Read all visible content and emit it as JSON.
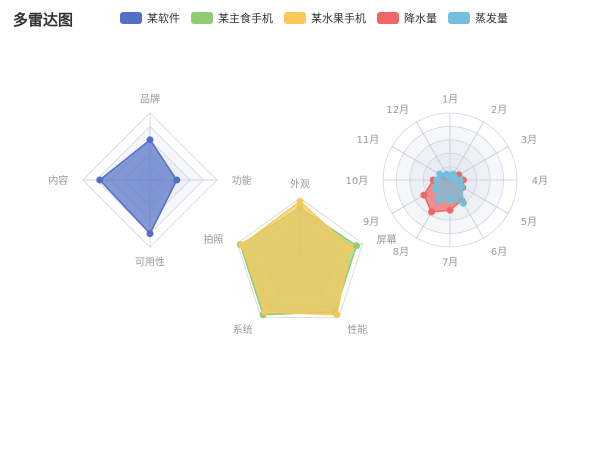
{
  "chart_data": {
    "type": "radar",
    "title": "多雷达图",
    "legend": [
      {
        "name": "某软件",
        "color": "#5470c6"
      },
      {
        "name": "某主食手机",
        "color": "#91cc75"
      },
      {
        "name": "某水果手机",
        "color": "#fac858"
      },
      {
        "name": "降水量",
        "color": "#ee6666"
      },
      {
        "name": "蒸发量",
        "color": "#73c0de"
      }
    ],
    "radars": [
      {
        "indicators": [
          {
            "name": "品牌",
            "max": 100
          },
          {
            "name": "功能",
            "max": 100
          },
          {
            "name": "可用性",
            "max": 100
          },
          {
            "name": "内容",
            "max": 100
          }
        ],
        "shape": "polygon",
        "series": [
          {
            "name": "某软件",
            "color": "#5470c6",
            "values": [
              60,
              40,
              80,
              75
            ]
          }
        ]
      },
      {
        "indicators": [
          {
            "name": "外观",
            "max": 100
          },
          {
            "name": "屏幕",
            "max": 100
          },
          {
            "name": "性能",
            "max": 100
          },
          {
            "name": "系统",
            "max": 100
          },
          {
            "name": "拍照",
            "max": 100
          }
        ],
        "shape": "polygon",
        "series": [
          {
            "name": "某主食手机",
            "color": "#91cc75",
            "values": [
              85,
              90,
              90,
              95,
              95
            ]
          },
          {
            "name": "某水果手机",
            "color": "#fac858",
            "values": [
              95,
              80,
              95,
              90,
              93
            ]
          }
        ]
      },
      {
        "indicators": [
          {
            "name": "1月",
            "max": 100
          },
          {
            "name": "2月",
            "max": 100
          },
          {
            "name": "3月",
            "max": 100
          },
          {
            "name": "4月",
            "max": 100
          },
          {
            "name": "5月",
            "max": 100
          },
          {
            "name": "6月",
            "max": 100
          },
          {
            "name": "7月",
            "max": 100
          },
          {
            "name": "8月",
            "max": 100
          },
          {
            "name": "9月",
            "max": 100
          },
          {
            "name": "10月",
            "max": 100
          },
          {
            "name": "11月",
            "max": 100
          },
          {
            "name": "12月",
            "max": 100
          }
        ],
        "shape": "circle",
        "series": [
          {
            "name": "降水量",
            "color": "#ee6666",
            "values": [
              4,
              10,
              15,
              20,
              22,
              35,
              45,
              55,
              45,
              25,
              10,
              5
            ]
          },
          {
            "name": "蒸发量",
            "color": "#73c0de",
            "values": [
              5,
              10,
              8,
              15,
              20,
              40,
              30,
              35,
              25,
              20,
              18,
              10
            ]
          }
        ]
      }
    ]
  }
}
